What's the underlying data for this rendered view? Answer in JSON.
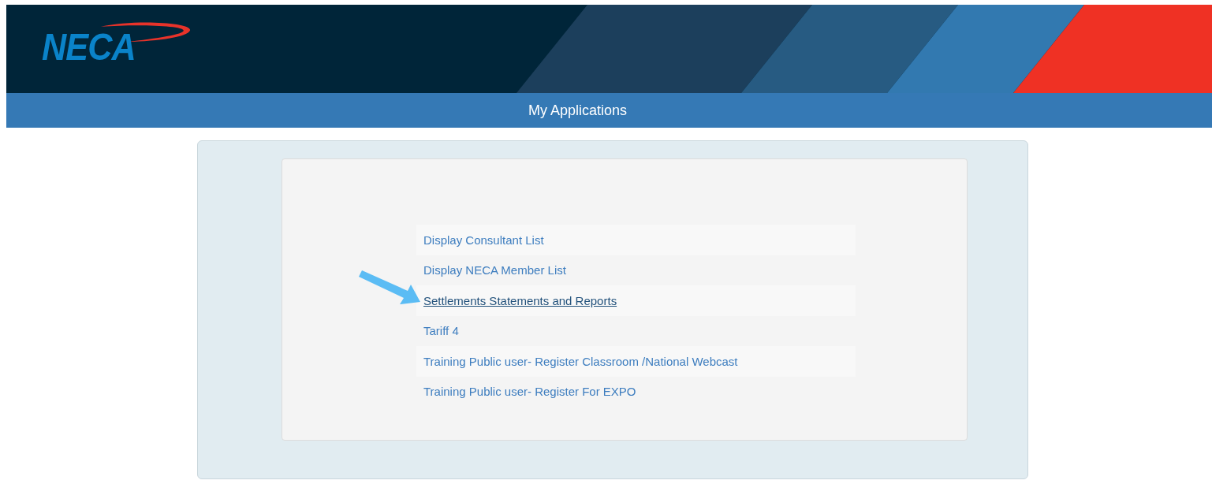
{
  "header": {
    "logo_text": "NECA"
  },
  "title_bar": {
    "title": "My Applications"
  },
  "applications": [
    {
      "label": "Display Consultant List",
      "hovered": false
    },
    {
      "label": "Display NECA Member List",
      "hovered": false
    },
    {
      "label": "Settlements Statements and Reports",
      "hovered": true
    },
    {
      "label": "Tariff 4",
      "hovered": false
    },
    {
      "label": "Training Public user- Register Classroom /National Webcast",
      "hovered": false
    },
    {
      "label": "Training Public user- Register For EXPO",
      "hovered": false
    }
  ]
}
